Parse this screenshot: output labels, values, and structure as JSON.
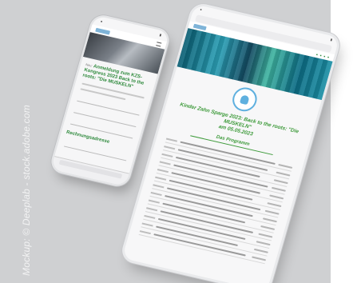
{
  "watermark": "Mockup: © Deeplab - stock.adobe.com",
  "colors": {
    "backdrop": "#cfd0d2",
    "accent_green": "#3d9a3a",
    "hero_teal": "#1c8fa5"
  },
  "phone": {
    "heading_lead": "Neu:",
    "heading": "Anmeldung zum KZS-Kongress 2023 Back to the roots: \"Die MUSKELN\"",
    "section_title": "Rechnungsadresse"
  },
  "tablet": {
    "title_line1": "Kinder Zahn Sparge 2023: Back to the roots: \"Die MUSKELN\"",
    "title_line2": "am 05.05.2023",
    "program_heading": "Das Programm"
  }
}
